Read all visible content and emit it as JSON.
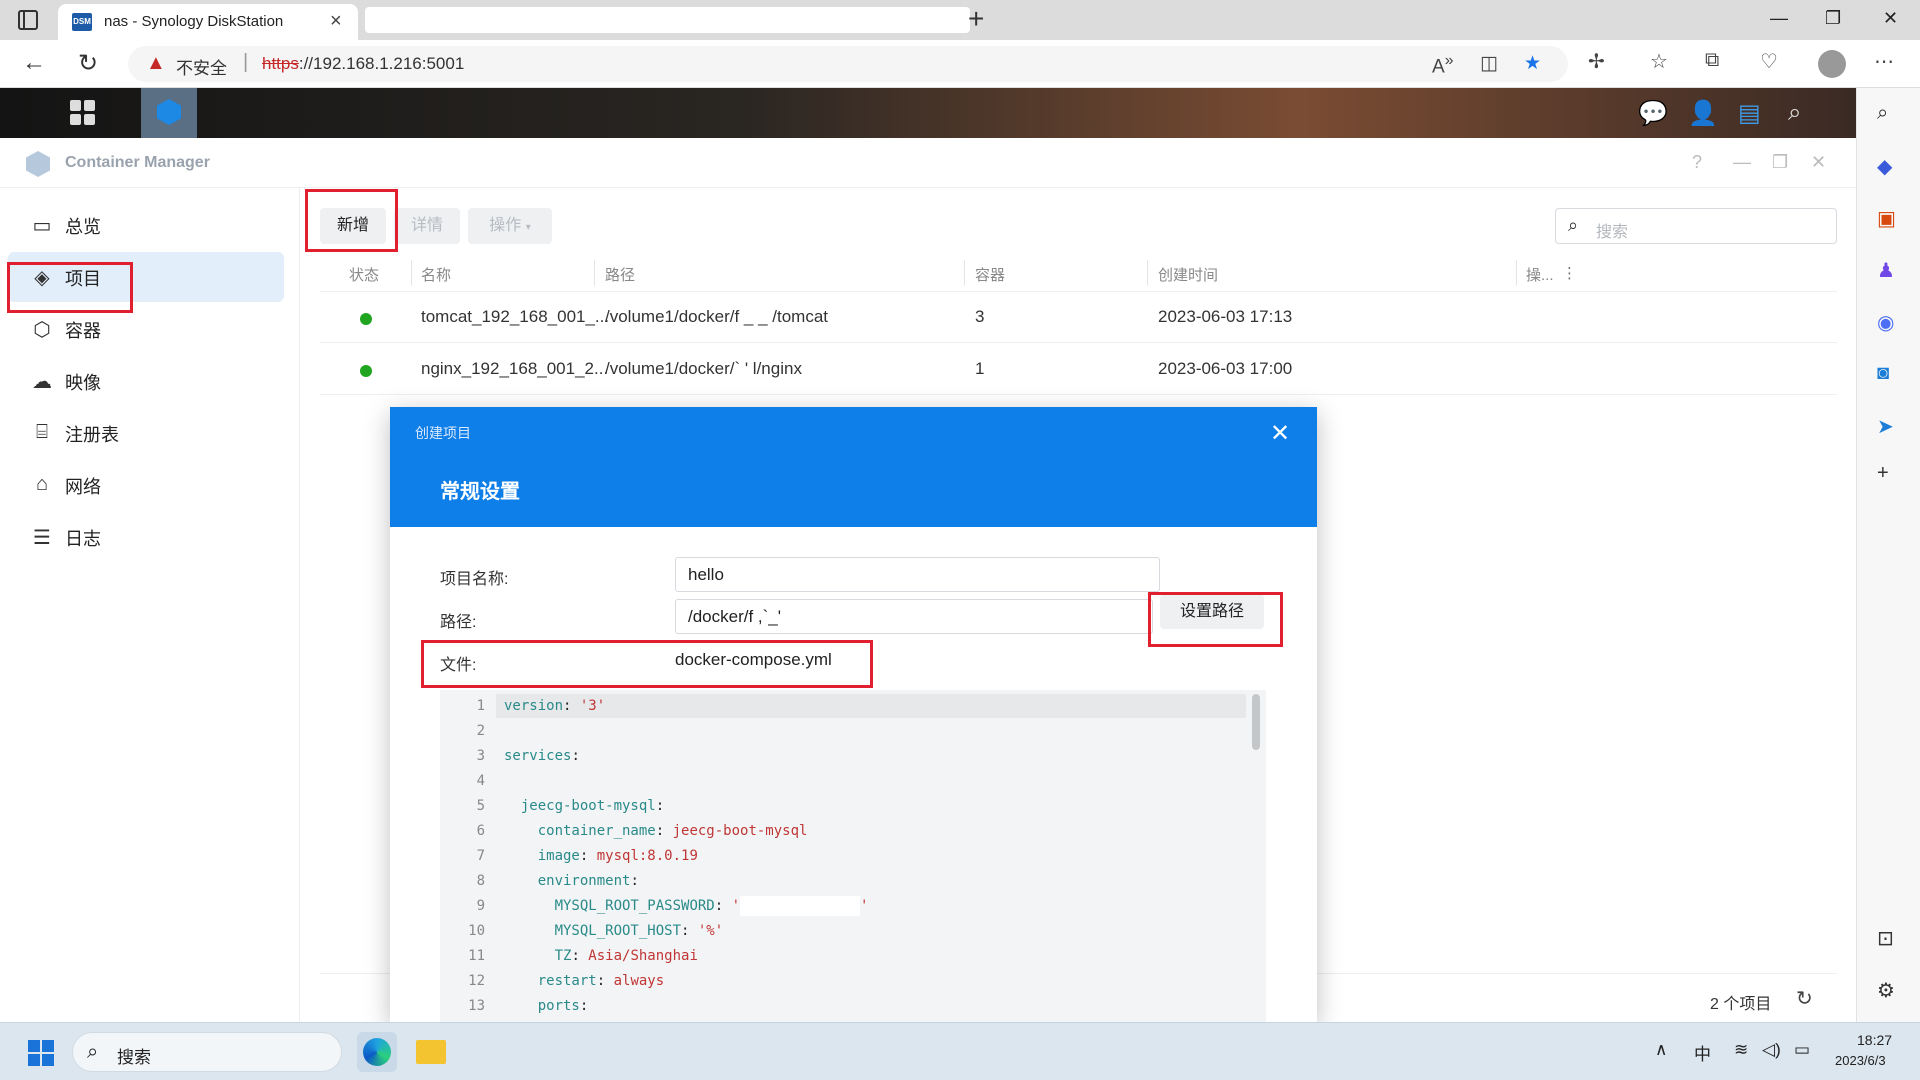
{
  "browser": {
    "tab_title": "nas - Synology DiskStation",
    "tab_favicon": "DSM",
    "insecure_label": "不安全",
    "url_scheme": "https",
    "url_rest": "://192.168.1.216:5001"
  },
  "app": {
    "title": "Container Manager"
  },
  "sidebar": {
    "items": [
      {
        "label": "总览",
        "icon": "overview-icon"
      },
      {
        "label": "项目",
        "icon": "layers-icon"
      },
      {
        "label": "容器",
        "icon": "cube-icon"
      },
      {
        "label": "映像",
        "icon": "cloud-icon"
      },
      {
        "label": "注册表",
        "icon": "registry-icon"
      },
      {
        "label": "网络",
        "icon": "network-icon"
      },
      {
        "label": "日志",
        "icon": "list-icon"
      }
    ],
    "active_index": 1
  },
  "toolbar": {
    "add": "新增",
    "details": "详情",
    "actions": "操作",
    "search_placeholder": "搜索"
  },
  "table": {
    "headers": [
      "状态",
      "名称",
      "路径",
      "容器",
      "创建时间",
      "操..."
    ],
    "rows": [
      {
        "name": "tomcat_192_168_001_...",
        "path": "/volume1/docker/f  _ _ /tomcat",
        "containers": "3",
        "created": "2023-06-03 17:13"
      },
      {
        "name": "nginx_192_168_001_2...",
        "path": "/volume1/docker/`    '  l/nginx",
        "containers": "1",
        "created": "2023-06-03 17:00"
      }
    ],
    "count": "2 个项目"
  },
  "modal": {
    "subtitle": "创建项目",
    "title": "常规设置",
    "name_label": "项目名称:",
    "name_value": "hello",
    "path_label": "路径:",
    "path_value": "/docker/f  ,`_'",
    "set_path_button": "设置路径",
    "file_label": "文件:",
    "file_value": "docker-compose.yml"
  },
  "code_lines": [
    {
      "n": "1",
      "t": [
        [
          "k",
          "version"
        ],
        [
          "",
          ": "
        ],
        [
          "s",
          "'3'"
        ]
      ]
    },
    {
      "n": "2",
      "t": []
    },
    {
      "n": "3",
      "t": [
        [
          "k",
          "services"
        ],
        [
          "",
          ":"
        ]
      ]
    },
    {
      "n": "4",
      "t": []
    },
    {
      "n": "5",
      "t": [
        [
          "",
          "  "
        ],
        [
          "k",
          "jeecg-boot-mysql"
        ],
        [
          "",
          ":"
        ]
      ]
    },
    {
      "n": "6",
      "t": [
        [
          "",
          "    "
        ],
        [
          "k",
          "container_name"
        ],
        [
          "",
          ": "
        ],
        [
          "s",
          "jeecg-boot-mysql"
        ]
      ]
    },
    {
      "n": "7",
      "t": [
        [
          "",
          "    "
        ],
        [
          "k",
          "image"
        ],
        [
          "",
          ": "
        ],
        [
          "s",
          "mysql:8.0.19"
        ]
      ]
    },
    {
      "n": "8",
      "t": [
        [
          "",
          "    "
        ],
        [
          "k",
          "environment"
        ],
        [
          "",
          ":"
        ]
      ]
    },
    {
      "n": "9",
      "t": [
        [
          "",
          "      "
        ],
        [
          "k",
          "MYSQL_ROOT_PASSWORD"
        ],
        [
          "",
          ": "
        ],
        [
          "s",
          "'"
        ],
        [
          "mask",
          ""
        ],
        [
          "s",
          "'"
        ]
      ]
    },
    {
      "n": "10",
      "t": [
        [
          "",
          "      "
        ],
        [
          "k",
          "MYSQL_ROOT_HOST"
        ],
        [
          "",
          ": "
        ],
        [
          "s",
          "'%'"
        ]
      ]
    },
    {
      "n": "11",
      "t": [
        [
          "",
          "      "
        ],
        [
          "k",
          "TZ"
        ],
        [
          "",
          ": "
        ],
        [
          "s",
          "Asia/Shanghai"
        ]
      ]
    },
    {
      "n": "12",
      "t": [
        [
          "",
          "    "
        ],
        [
          "k",
          "restart"
        ],
        [
          "",
          ": "
        ],
        [
          "s",
          "always"
        ]
      ]
    },
    {
      "n": "13",
      "t": [
        [
          "",
          "    "
        ],
        [
          "k",
          "ports"
        ],
        [
          "",
          ":"
        ]
      ]
    }
  ],
  "taskbar": {
    "search": "搜索",
    "ime": "中",
    "time": "18:27",
    "date": "2023/6/3"
  }
}
